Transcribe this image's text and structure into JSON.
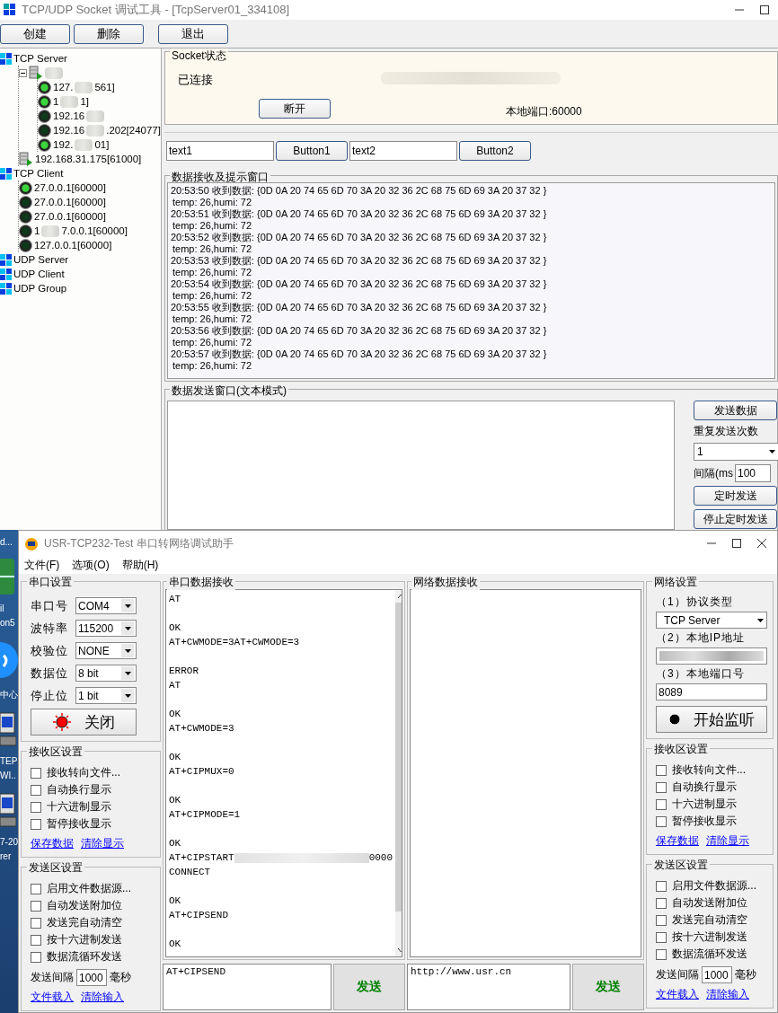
{
  "main_window": {
    "title": "TCP/UDP Socket 调试工具 - [TcpServer01_334108]",
    "toolbar": [
      {
        "label": "创建"
      },
      {
        "label": "删除"
      },
      {
        "label": "退出"
      }
    ],
    "tree": [
      {
        "kind": "category",
        "label": "TCP Server",
        "children": [
          {
            "kind": "server",
            "expanded": true,
            "redacted": true,
            "children": [
              {
                "kind": "connection",
                "active": true,
                "redacted": true,
                "label": "127.",
                "label_tail": "561]"
              },
              {
                "kind": "connection",
                "active": true,
                "redacted": true,
                "label": "1",
                "label_tail": "1]"
              },
              {
                "kind": "connection",
                "active": false,
                "redacted": true,
                "label": "192.16"
              },
              {
                "kind": "connection",
                "active": false,
                "redacted": true,
                "label": "192.16",
                "label_tail": ".202[24077]"
              },
              {
                "kind": "connection",
                "active": true,
                "redacted": true,
                "label": "192.",
                "label_tail": "01]"
              }
            ]
          },
          {
            "kind": "server",
            "label": "192.168.31.175[61000]"
          }
        ]
      },
      {
        "kind": "category",
        "label": "TCP Client",
        "children": [
          {
            "kind": "connection",
            "active": true,
            "label": "27.0.0.1[60000]"
          },
          {
            "kind": "connection",
            "active": false,
            "label": "27.0.0.1[60000]"
          },
          {
            "kind": "connection",
            "active": false,
            "label": "27.0.0.1[60000]"
          },
          {
            "kind": "connection",
            "active": false,
            "redacted": true,
            "label": "1",
            "label_tail": "7.0.0.1[60000]"
          },
          {
            "kind": "connection",
            "active": false,
            "label": "127.0.0.1[60000]"
          }
        ]
      },
      {
        "kind": "category",
        "label": "UDP Server"
      },
      {
        "kind": "category",
        "label": "UDP Client"
      },
      {
        "kind": "category",
        "label": "UDP Group"
      }
    ],
    "socket_status": {
      "title": "Socket状态",
      "status": "已连接",
      "disconnect_button": "断开",
      "local_port": "本地端口:60000"
    },
    "quick_bar": [
      {
        "kind": "field",
        "value": "text1"
      },
      {
        "kind": "button",
        "label": "Button1"
      },
      {
        "kind": "field",
        "value": "text2"
      },
      {
        "kind": "button",
        "label": "Button2"
      }
    ],
    "receive": {
      "title": "数据接收及提示窗口",
      "messages": [
        {
          "line": "20:53:50 收到数据: {0D 0A 20 74 65 6D 70 3A 20 32 36 2C 68 75 6D 69 3A 20 37 32 }",
          "detail": "temp: 26,humi: 72"
        },
        {
          "line": "20:53:51 收到数据: {0D 0A 20 74 65 6D 70 3A 20 32 36 2C 68 75 6D 69 3A 20 37 32 }",
          "detail": "temp: 26,humi: 72"
        },
        {
          "line": "20:53:52 收到数据: {0D 0A 20 74 65 6D 70 3A 20 32 36 2C 68 75 6D 69 3A 20 37 32 }",
          "detail": "temp: 26,humi: 72"
        },
        {
          "line": "20:53:53 收到数据: {0D 0A 20 74 65 6D 70 3A 20 32 36 2C 68 75 6D 69 3A 20 37 32 }",
          "detail": "temp: 26,humi: 72"
        },
        {
          "line": "20:53:54 收到数据: {0D 0A 20 74 65 6D 70 3A 20 32 36 2C 68 75 6D 69 3A 20 37 32 }",
          "detail": "temp: 26,humi: 72"
        },
        {
          "line": "20:53:55 收到数据: {0D 0A 20 74 65 6D 70 3A 20 32 36 2C 68 75 6D 69 3A 20 37 32 }",
          "detail": "temp: 26,humi: 72"
        },
        {
          "line": "20:53:56 收到数据: {0D 0A 20 74 65 6D 70 3A 20 32 36 2C 68 75 6D 69 3A 20 37 32 }",
          "detail": "temp: 26,humi: 72"
        },
        {
          "line": "20:53:57 收到数据: {0D 0A 20 74 65 6D 70 3A 20 32 36 2C 68 75 6D 69 3A 20 37 32 }",
          "detail": "temp: 26,humi: 72"
        }
      ]
    },
    "send": {
      "title": "数据发送窗口(文本模式)",
      "send_button": "发送数据",
      "repeat_label": "重复发送次数",
      "repeat_value": "1",
      "interval_label": "间隔(ms",
      "interval_value": "100",
      "timer_button": "定时发送",
      "stop_button": "停止定时发送"
    }
  },
  "desktop": [
    {
      "kind": "label",
      "text": "d..."
    },
    {
      "kind": "tile"
    },
    {
      "kind": "label",
      "text": "il"
    },
    {
      "kind": "label",
      "text": "on5"
    },
    {
      "kind": "circle"
    },
    {
      "kind": "label",
      "text": "中心"
    },
    {
      "kind": "computer"
    },
    {
      "kind": "label",
      "text": "TEP"
    },
    {
      "kind": "label",
      "text": "WI.."
    },
    {
      "kind": "computer"
    },
    {
      "kind": "label",
      "text": "7-20"
    },
    {
      "kind": "label",
      "text": "rer"
    }
  ],
  "serial_tool": {
    "title": "USR-TCP232-Test 串口转网络调试助手",
    "menu": [
      {
        "label": "文件(F)"
      },
      {
        "label": "选项(O)"
      },
      {
        "label": "帮助(H)"
      }
    ],
    "serial_settings": {
      "title": "串口设置",
      "rows": [
        {
          "label": "串口号",
          "value": "COM4"
        },
        {
          "label": "波特率",
          "value": "115200"
        },
        {
          "label": "校验位",
          "value": "NONE"
        },
        {
          "label": "数据位",
          "value": "8 bit"
        },
        {
          "label": "停止位",
          "value": "1 bit"
        }
      ],
      "close_button": "关闭"
    },
    "serial_receive_settings": {
      "title": "接收区设置",
      "options": [
        {
          "label": "接收转向文件...",
          "checked": false
        },
        {
          "label": "自动换行显示",
          "checked": false
        },
        {
          "label": "十六进制显示",
          "checked": false
        },
        {
          "label": "暂停接收显示",
          "checked": false
        }
      ],
      "links": [
        "保存数据",
        "清除显示"
      ]
    },
    "serial_send_settings": {
      "title": "发送区设置",
      "options": [
        {
          "label": "启用文件数据源...",
          "checked": false
        },
        {
          "label": "自动发送附加位",
          "checked": false
        },
        {
          "label": "发送完自动清空",
          "checked": false
        },
        {
          "label": "按十六进制发送",
          "checked": false
        },
        {
          "label": "数据流循环发送",
          "checked": false
        }
      ],
      "interval_label": "发送间隔",
      "interval_value": "1000",
      "interval_unit": "毫秒",
      "links": [
        "文件载入",
        "清除输入"
      ]
    },
    "serial_receive": {
      "title": "串口数据接收",
      "blocks": [
        [
          "AT"
        ],
        [
          "OK",
          "AT+CWMODE=3AT+CWMODE=3"
        ],
        [
          "ERROR",
          "AT"
        ],
        [
          "OK",
          "AT+CWMODE=3"
        ],
        [
          "OK",
          "AT+CIPMUX=0"
        ],
        [
          "OK",
          "AT+CIPMODE=1"
        ],
        [
          "OK",
          {
            "text": "AT+CIPSTART",
            "tail": "0000"
          },
          "CONNECT"
        ],
        [
          "OK",
          "AT+CIPSEND"
        ],
        [
          "OK"
        ]
      ]
    },
    "serial_input": {
      "value": "AT+CIPSEND",
      "send_button": "发送"
    },
    "network_receive": {
      "title": "网络数据接收"
    },
    "network_input": {
      "value": "http://www.usr.cn",
      "send_button": "发送"
    },
    "network_settings": {
      "title": "网络设置",
      "protocol_label": "（1）协议类型",
      "protocol_value": "TCP Server",
      "ip_label": "（2）本地IP地址",
      "port_label": "（3）本地端口号",
      "port_value": "8089",
      "listen_button": "开始监听"
    },
    "network_receive_settings": {
      "title": "接收区设置",
      "options": [
        {
          "label": "接收转向文件...",
          "checked": false
        },
        {
          "label": "自动换行显示",
          "checked": false
        },
        {
          "label": "十六进制显示",
          "checked": false
        },
        {
          "label": "暂停接收显示",
          "checked": false
        }
      ],
      "links": [
        "保存数据",
        "清除显示"
      ]
    },
    "network_send_settings": {
      "title": "发送区设置",
      "options": [
        {
          "label": "启用文件数据源...",
          "checked": false
        },
        {
          "label": "自动发送附加位",
          "checked": false
        },
        {
          "label": "发送完自动清空",
          "checked": false
        },
        {
          "label": "按十六进制发送",
          "checked": false
        },
        {
          "label": "数据流循环发送",
          "checked": false
        }
      ],
      "interval_label": "发送间隔",
      "interval_value": "1000",
      "interval_unit": "毫秒",
      "links": [
        "文件载入",
        "清除输入"
      ]
    }
  }
}
